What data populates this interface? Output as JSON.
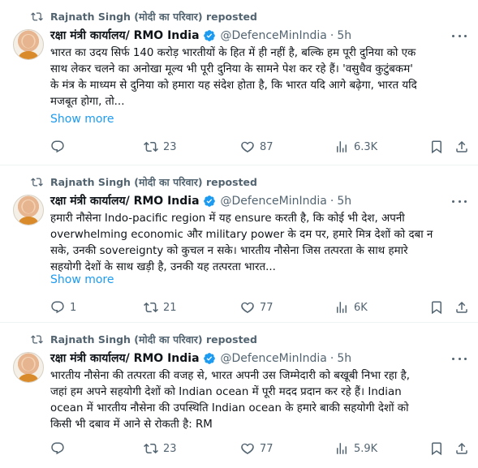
{
  "tweets": [
    {
      "reposted_by": "Rajnath Singh (मोदी का परिवार) reposted",
      "name": "रक्षा मंत्री कार्यालय/ RMO India",
      "handle": "@DefenceMinIndia",
      "separator": "·",
      "time": "5h",
      "text": "भारत का उदय सिर्फ 140 करोड़ भारतीयों के हित में ही नहीं है, बल्कि हम पूरी दुनिया को एक\nसाथ लेकर चलने का अनोखा मूल्य भी पूरी दुनिया के सामने पेश कर रहे हैं। 'वसुधैव कुटुंबकम'\nके मंत्र के माध्यम से दुनिया को हमारा यह संदेश होता है, कि भारत यदि आगे बढ़ेगा, भारत यदि\nमजबूत होगा, तो...",
      "show_more": "Show more",
      "replies": "",
      "reposts": "23",
      "likes": "87",
      "views": "6.3K"
    },
    {
      "reposted_by": "Rajnath Singh (मोदी का परिवार) reposted",
      "name": "रक्षा मंत्री कार्यालय/ RMO India",
      "handle": "@DefenceMinIndia",
      "separator": "·",
      "time": "5h",
      "text": "हमारी नौसेना Indo-pacific region में यह ensure करती है, कि कोई भी देश, अपनी\noverwhelming economic और military power के दम पर, हमारे मित्र देशों को दबा न\nसके, उनकी sovereignty को कुचल न सके। भारतीय नौसेना जिस तत्परता के साथ हमारे\nसहयोगी देशों के साथ खड़ी है, उनकी यह तत्परता भारत...",
      "show_more": "Show more",
      "replies": "1",
      "reposts": "21",
      "likes": "77",
      "views": "6K"
    },
    {
      "reposted_by": "Rajnath Singh (मोदी का परिवार) reposted",
      "name": "रक्षा मंत्री कार्यालय/ RMO India",
      "handle": "@DefenceMinIndia",
      "separator": "·",
      "time": "5h",
      "text": "भारतीय नौसेना की तत्परता की वजह से, भारत अपनी उस जिम्मेदारी को बखूबी निभा रहा है,\nजहां हम अपने सहयोगी देशों को Indian ocean में पूरी मदद प्रदान कर रहे हैं। Indian\nocean में भारतीय नौसेना की उपस्थिति Indian ocean के हमारे बाकी सहयोगी देशों को\nकिसी भी दबाव में आने से रोकती है: RM",
      "replies": "",
      "reposts": "23",
      "likes": "77",
      "views": "5.9K"
    }
  ],
  "icons": {
    "repost": "repost-icon",
    "verified": "verified-badge-icon",
    "more": "more-options-icon",
    "reply": "reply-icon",
    "retweet": "retweet-icon",
    "like": "heart-icon",
    "views": "views-icon",
    "bookmark": "bookmark-icon",
    "share": "share-icon"
  },
  "colors": {
    "text": "#0f1419",
    "secondary": "#536471",
    "link": "#1d9bf0",
    "verified": "#1d9bf0",
    "divider": "#eff3f4"
  }
}
